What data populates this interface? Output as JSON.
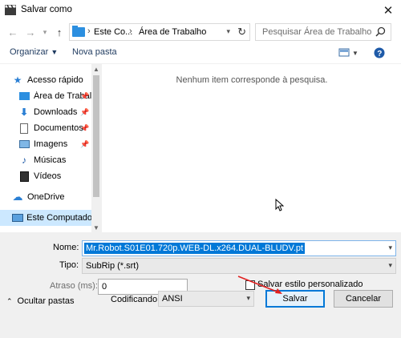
{
  "window": {
    "title": "Salvar como",
    "close_icon": "close-icon"
  },
  "navbar": {
    "breadcrumbs": [
      "Este Co...",
      "Área de Trabalho"
    ],
    "search_placeholder": "Pesquisar Área de Trabalho"
  },
  "toolbar": {
    "organize_label": "Organizar",
    "new_folder_label": "Nova pasta"
  },
  "sidebar": {
    "items": [
      {
        "label": "Acesso rápido",
        "icon": "star-icon"
      },
      {
        "label": "Área de Trabalho",
        "icon": "desktop-folder-icon",
        "pinned": true
      },
      {
        "label": "Downloads",
        "icon": "download-icon",
        "pinned": true
      },
      {
        "label": "Documentos",
        "icon": "document-icon",
        "pinned": true
      },
      {
        "label": "Imagens",
        "icon": "image-icon",
        "pinned": true
      },
      {
        "label": "Músicas",
        "icon": "music-icon"
      },
      {
        "label": "Vídeos",
        "icon": "video-icon"
      },
      {
        "label": "OneDrive",
        "icon": "cloud-icon"
      },
      {
        "label": "Este Computador",
        "icon": "computer-icon",
        "selected": true
      }
    ]
  },
  "content": {
    "empty_message": "Nenhum item corresponde à pesquisa."
  },
  "form": {
    "name_label": "Nome:",
    "name_value": "Mr.Robot.S01E01.720p.WEB-DL.x264.DUAL-BLUDV.pt",
    "type_label": "Tipo:",
    "type_value": "SubRip (*.srt)",
    "delay_label": "Atraso (ms):",
    "delay_value": "0",
    "custom_style_label": "Salvar estilo personalizado",
    "encoding_label": "Codificando:",
    "encoding_value": "ANSI"
  },
  "footer": {
    "hide_folders_label": "Ocultar pastas",
    "save_label": "Salvar",
    "cancel_label": "Cancelar"
  },
  "colors": {
    "accent": "#0078d7",
    "selection": "#cce8ff",
    "annotation_arrow": "#e02020"
  }
}
